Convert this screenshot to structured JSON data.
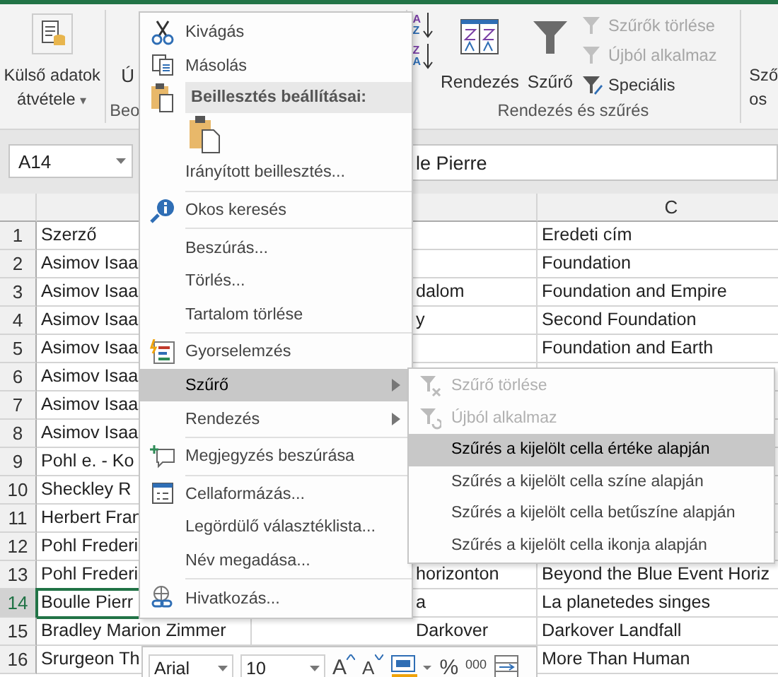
{
  "ribbon": {
    "external_data": {
      "line1": "Külső adatok",
      "line2": "átvétele",
      "caret": "▾"
    },
    "partial_button": "Ú",
    "partial_group": "Beo",
    "sort_group": {
      "sort_ascending": {
        "top": "A",
        "bottom": "Z"
      },
      "sort_descending": {
        "top": "Z",
        "bottom": "A"
      },
      "sort_button": "Rendezés",
      "filter_button": "Szűrő",
      "small_items": [
        {
          "label": "Szűrők törlése",
          "disabled": true
        },
        {
          "label": "Újból alkalmaz",
          "disabled": true
        },
        {
          "label": "Speciális",
          "disabled": false
        }
      ],
      "label": "Rendezés és szűrés"
    },
    "partial_right": {
      "line1": "Sző",
      "line2": "os"
    }
  },
  "formula_bar": {
    "name_box": "A14",
    "value": "le Pierre"
  },
  "columns": [
    {
      "label": "C"
    }
  ],
  "rows": [
    {
      "number": "1",
      "selected": false,
      "a": "Szerző",
      "c": "Eredeti cím"
    },
    {
      "number": "2",
      "selected": false,
      "a": "Asimov Isaa",
      "c": "Foundation"
    },
    {
      "number": "3",
      "selected": false,
      "a": "Asimov Isaa",
      "b": "dalom",
      "c": "Foundation and Empire"
    },
    {
      "number": "4",
      "selected": false,
      "a": "Asimov Isaa",
      "b": "y",
      "c": "Second Foundation"
    },
    {
      "number": "5",
      "selected": false,
      "a": "Asimov Isaa",
      "c": "Foundation and Earth"
    },
    {
      "number": "6",
      "selected": false,
      "a": "Asimov Isaa"
    },
    {
      "number": "7",
      "selected": false,
      "a": "Asimov Isaa"
    },
    {
      "number": "8",
      "selected": false,
      "a": "Asimov Isaa"
    },
    {
      "number": "9",
      "selected": false,
      "a": "Pohl e. - Ko"
    },
    {
      "number": "10",
      "selected": false,
      "a": "Sheckley R"
    },
    {
      "number": "11",
      "selected": false,
      "a": "Herbert Fran"
    },
    {
      "number": "12",
      "selected": false,
      "a": "Pohl Frederi"
    },
    {
      "number": "13",
      "selected": false,
      "a": "Pohl Frederi",
      "b": "horizonton",
      "c": "Beyond the Blue Event Horiz"
    },
    {
      "number": "14",
      "selected": true,
      "a": "Boulle Pierr",
      "b": "a",
      "c": "La planetedes singes"
    },
    {
      "number": "15",
      "selected": false,
      "a": "Bradley Marion Zimmer",
      "b": "Darkover",
      "c": "Darkover Landfall"
    },
    {
      "number": "16",
      "selected": false,
      "a": "Srurgeon Th",
      "c": "More Than Human"
    }
  ],
  "context_menu": [
    {
      "kind": "item",
      "label": "Kivágás",
      "selected": false,
      "submenu": false
    },
    {
      "kind": "item",
      "label": "Másolás",
      "selected": false,
      "submenu": false
    },
    {
      "kind": "header",
      "label": "Beillesztés beállításai:"
    },
    {
      "kind": "paste"
    },
    {
      "kind": "item",
      "label": "Irányított beillesztés...",
      "selected": false,
      "submenu": false
    },
    {
      "kind": "separator"
    },
    {
      "kind": "item",
      "label": "Okos keresés",
      "selected": false,
      "submenu": false
    },
    {
      "kind": "separator"
    },
    {
      "kind": "item",
      "label": "Beszúrás...",
      "selected": false,
      "submenu": false
    },
    {
      "kind": "item",
      "label": "Törlés...",
      "selected": false,
      "submenu": false
    },
    {
      "kind": "item",
      "label": "Tartalom törlése",
      "selected": false,
      "submenu": false
    },
    {
      "kind": "separator"
    },
    {
      "kind": "item",
      "label": "Gyorselemzés",
      "selected": false,
      "submenu": false
    },
    {
      "kind": "item",
      "label": "Szűrő",
      "selected": true,
      "submenu": true
    },
    {
      "kind": "item",
      "label": "Rendezés",
      "selected": false,
      "submenu": true
    },
    {
      "kind": "separator"
    },
    {
      "kind": "item",
      "label": "Megjegyzés beszúrása",
      "selected": false,
      "submenu": false
    },
    {
      "kind": "separator"
    },
    {
      "kind": "item",
      "label": "Cellaformázás...",
      "selected": false,
      "submenu": false
    },
    {
      "kind": "item",
      "label": "Legördülő választéklista...",
      "selected": false,
      "submenu": false
    },
    {
      "kind": "item",
      "label": "Név megadása...",
      "selected": false,
      "submenu": false
    },
    {
      "kind": "separator"
    },
    {
      "kind": "item",
      "label": "Hivatkozás...",
      "selected": false,
      "submenu": false
    }
  ],
  "submenu": [
    {
      "label": "Szűrő törlése",
      "selected": false,
      "disabled": true
    },
    {
      "label": "Újból alkalmaz",
      "selected": false,
      "disabled": true
    },
    {
      "label": "Szűrés a kijelölt cella értéke alapján",
      "selected": true,
      "disabled": false
    },
    {
      "label": "Szűrés a kijelölt cella színe alapján",
      "selected": false,
      "disabled": false
    },
    {
      "label": "Szűrés a kijelölt cella betűszíne alapján",
      "selected": false,
      "disabled": false
    },
    {
      "label": "Szűrés a kijelölt cella ikonja alapján",
      "selected": false,
      "disabled": false
    }
  ],
  "mini_toolbar": {
    "font": "Arial",
    "size": "10",
    "grow": "A",
    "shrink": "A",
    "percent": "%",
    "thousands": "000"
  }
}
